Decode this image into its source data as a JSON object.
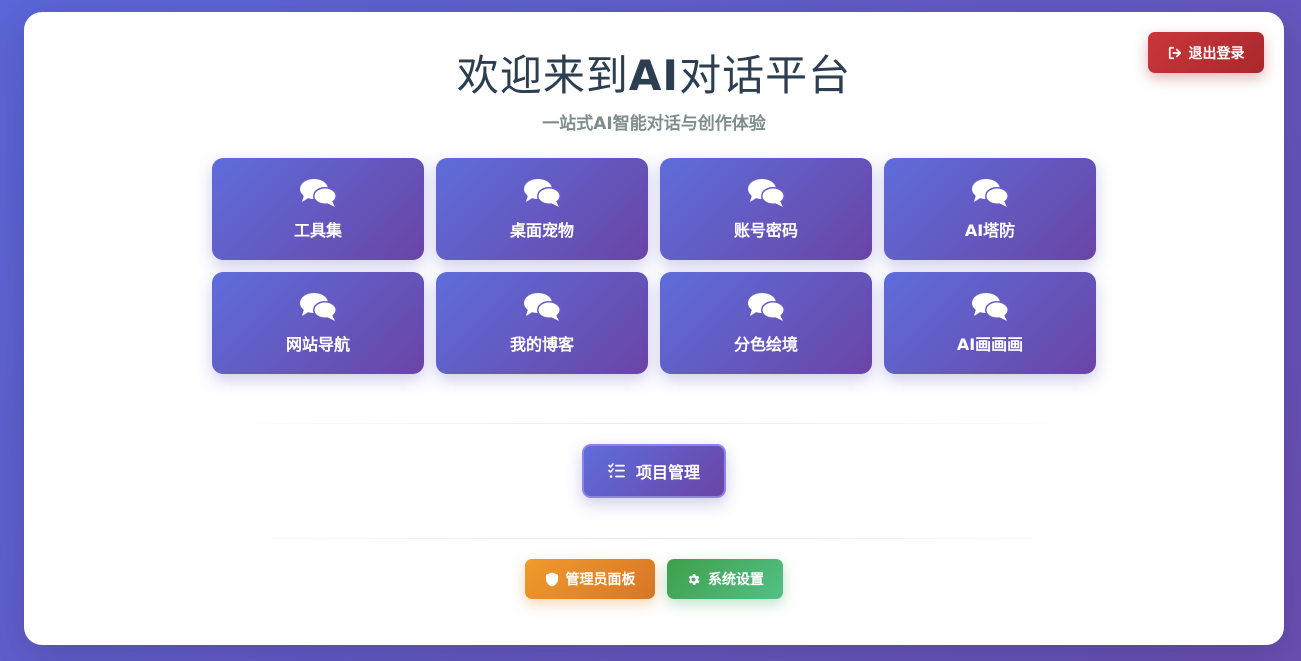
{
  "header": {
    "title_prefix": "欢迎来到",
    "title_highlight": "AI",
    "title_suffix": "对话平台",
    "subtitle": "一站式AI智能对话与创作体验"
  },
  "logout": {
    "label": "退出登录",
    "icon": "sign-out-icon"
  },
  "tiles": [
    {
      "label": "工具集",
      "icon": "comments-icon"
    },
    {
      "label": "桌面宠物",
      "icon": "comments-icon"
    },
    {
      "label": "账号密码",
      "icon": "comments-icon"
    },
    {
      "label": "AI塔防",
      "icon": "comments-icon"
    },
    {
      "label": "网站导航",
      "icon": "comments-icon"
    },
    {
      "label": "我的博客",
      "icon": "comments-icon"
    },
    {
      "label": "分色绘境",
      "icon": "comments-icon"
    },
    {
      "label": "AI画画画",
      "icon": "comments-icon"
    }
  ],
  "project": {
    "label": "项目管理",
    "icon": "tasks-icon"
  },
  "admin": {
    "label": "管理员面板",
    "icon": "shield-icon"
  },
  "settings": {
    "label": "系统设置",
    "icon": "gear-icon"
  },
  "colors": {
    "primary_start": "#5e6ddb",
    "primary_end": "#6a45a6",
    "logout": "#c9373a",
    "admin": "#f09b2b",
    "settings": "#3f9f4a"
  }
}
